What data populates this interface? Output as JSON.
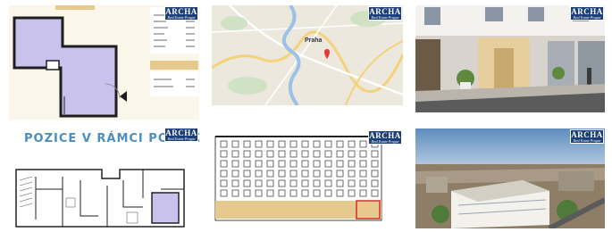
{
  "gallery": {
    "brand": "ARCHA",
    "brand_tagline": "Real Estate Prague",
    "floorplan_heading": "POZICE V RÁMCI PODLAŽÍ",
    "map_city_label": "Praha"
  },
  "colors": {
    "brand_blue": "#1c3f7a",
    "unit_purple": "#c9c2ec",
    "panel_gold": "#e6c98d",
    "heading_blue": "#4a8fbf"
  }
}
